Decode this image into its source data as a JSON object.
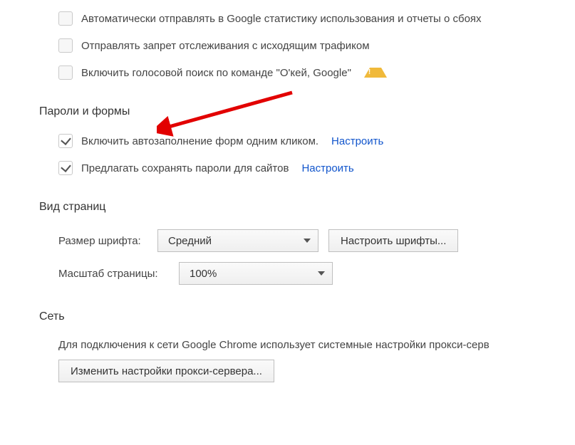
{
  "privacy": {
    "cb1": "Автоматически отправлять в Google статистику использования и отчеты о сбоях",
    "cb2": "Отправлять запрет отслеживания с исходящим трафиком",
    "cb3": "Включить голосовой поиск по команде \"О'кей, Google\""
  },
  "passwords": {
    "heading": "Пароли и формы",
    "autofill": "Включить автозаполнение форм одним кликом.",
    "offer_save": "Предлагать сохранять пароли для сайтов",
    "configure": "Настроить"
  },
  "appearance": {
    "heading": "Вид страниц",
    "font_label": "Размер шрифта:",
    "font_value": "Средний",
    "font_btn": "Настроить шрифты...",
    "zoom_label": "Масштаб страницы:",
    "zoom_value": "100%"
  },
  "network": {
    "heading": "Сеть",
    "text": "Для подключения к сети Google Chrome использует системные настройки прокси-серв",
    "btn": "Изменить настройки прокси-сервера..."
  }
}
